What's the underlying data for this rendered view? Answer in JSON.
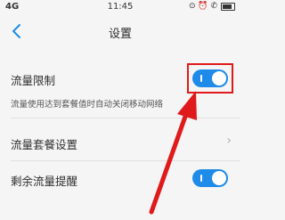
{
  "status_bar": {
    "signal": "4G",
    "time": "11:45",
    "right_icons": "⊙ ⏰ ✆",
    "battery_icon": "battery-icon"
  },
  "header": {
    "back_icon": "chevron-left-icon",
    "title": "设置"
  },
  "settings": [
    {
      "label": "流量限制",
      "description": "流量使用达到套餐值时自动关闭移动网络",
      "type": "toggle",
      "on": true
    },
    {
      "label": "流量套餐设置",
      "type": "link"
    },
    {
      "label": "剩余流量提醒",
      "type": "toggle",
      "on": true
    }
  ],
  "colors": {
    "toggle_on": "#1e8be8",
    "annotation_red": "#e01a1a",
    "background": "#f5f5f5"
  }
}
